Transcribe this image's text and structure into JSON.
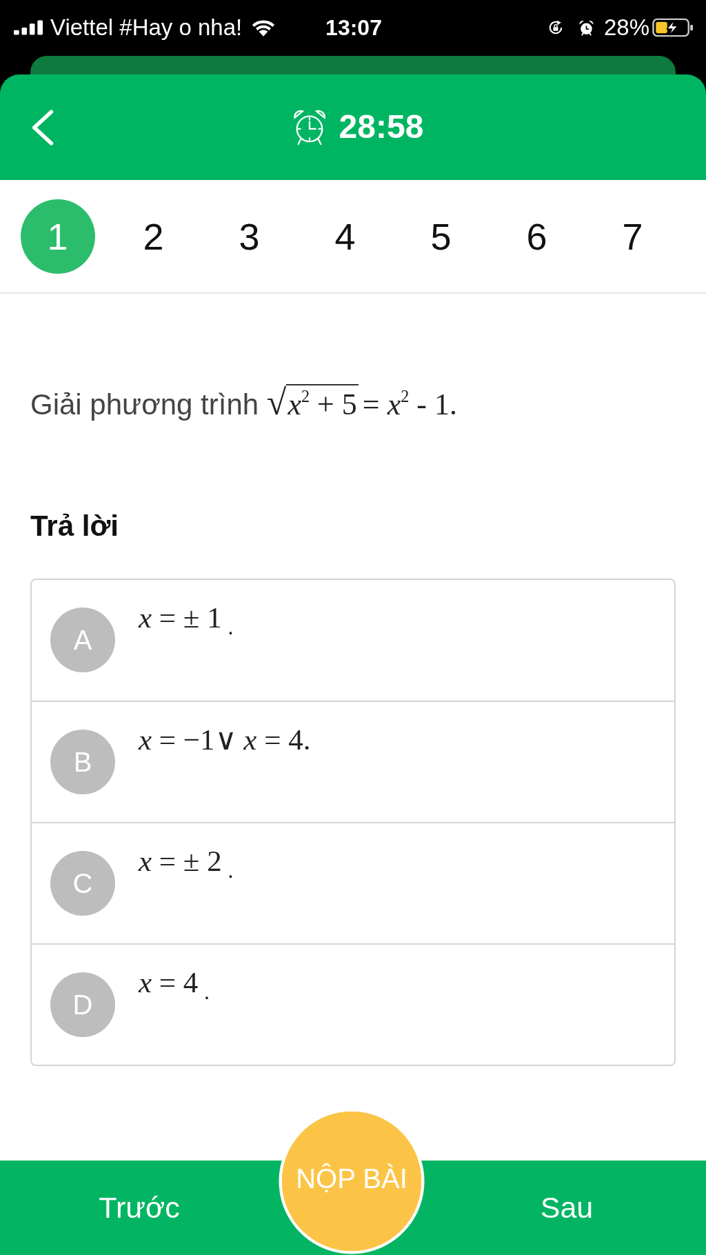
{
  "status_bar": {
    "carrier": "Viettel #Hay o nha!",
    "time": "13:07",
    "battery": "28%"
  },
  "header": {
    "timer": "28:58"
  },
  "tabs": [
    {
      "label": "1",
      "selected": true
    },
    {
      "label": "2",
      "selected": false
    },
    {
      "label": "3",
      "selected": false
    },
    {
      "label": "4",
      "selected": false
    },
    {
      "label": "5",
      "selected": false
    },
    {
      "label": "6",
      "selected": false
    },
    {
      "label": "7",
      "selected": false
    }
  ],
  "question": {
    "prompt": "Giải phương trình",
    "formula": {
      "radical": "√",
      "radicand": "*x*$^{2}$ + 5",
      "rest": "= *x*$^{2}$ - 1."
    }
  },
  "answer_heading": "Trả lời",
  "answers": [
    {
      "letter": "A",
      "formula": "*x* = ± 1",
      "tail": ".",
      "selected": false
    },
    {
      "letter": "B",
      "formula": "*x* = −1∨ *x* = 4.",
      "selected": false
    },
    {
      "letter": "C",
      "formula": "*x* = ± 2",
      "tail": ".",
      "selected": false
    },
    {
      "letter": "D",
      "formula": "*x* = 4",
      "tail": ".",
      "selected": false
    }
  ],
  "bottom_bar": {
    "previous": "Trước",
    "submit": "NỘP BÀI",
    "next": "Sau"
  }
}
